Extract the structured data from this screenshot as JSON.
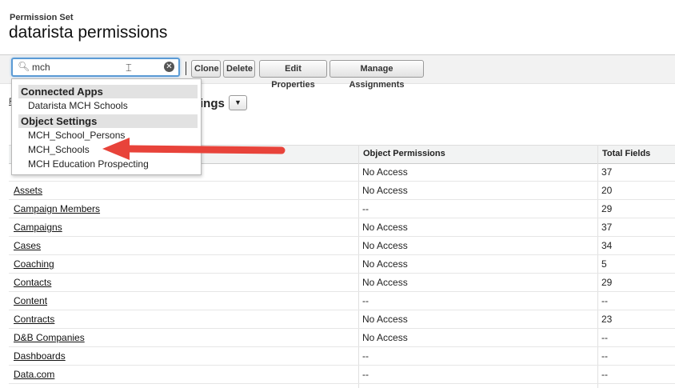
{
  "header": {
    "subtitle": "Permission Set",
    "title": "datarista permissions"
  },
  "search": {
    "value": "mch",
    "icon": "search-icon"
  },
  "toolbar": {
    "clone_label": "Clone",
    "delete_label": "Delete",
    "edit_properties_label": "Edit Properties",
    "manage_assignments_label": "Manage Assignments"
  },
  "background": {
    "partial_title": "ings",
    "partial_link": "P"
  },
  "dropdown": {
    "groups": [
      {
        "label": "Connected Apps",
        "items": [
          "Datarista MCH Schools"
        ]
      },
      {
        "label": "Object Settings",
        "items": [
          "MCH_School_Persons",
          "MCH_Schools",
          "MCH Education Prospecting"
        ]
      }
    ]
  },
  "annotation": {
    "arrow_color": "#e8433a",
    "points_to": "MCH_Schools"
  },
  "table": {
    "columns": [
      "Object Permissions",
      "Total Fields"
    ],
    "rows": [
      {
        "name": "",
        "perm": "No Access",
        "fields": "37"
      },
      {
        "name": "Assets",
        "perm": "No Access",
        "fields": "20"
      },
      {
        "name": "Campaign Members",
        "perm": "--",
        "fields": "29"
      },
      {
        "name": "Campaigns",
        "perm": "No Access",
        "fields": "37"
      },
      {
        "name": "Cases",
        "perm": "No Access",
        "fields": "34"
      },
      {
        "name": "Coaching",
        "perm": "No Access",
        "fields": "5"
      },
      {
        "name": "Contacts",
        "perm": "No Access",
        "fields": "29"
      },
      {
        "name": "Content",
        "perm": "--",
        "fields": "--"
      },
      {
        "name": "Contracts",
        "perm": "No Access",
        "fields": "23"
      },
      {
        "name": "D&B Companies",
        "perm": "No Access",
        "fields": "--"
      },
      {
        "name": "Dashboards",
        "perm": "--",
        "fields": "--"
      },
      {
        "name": "Data.com",
        "perm": "--",
        "fields": "--"
      }
    ]
  }
}
